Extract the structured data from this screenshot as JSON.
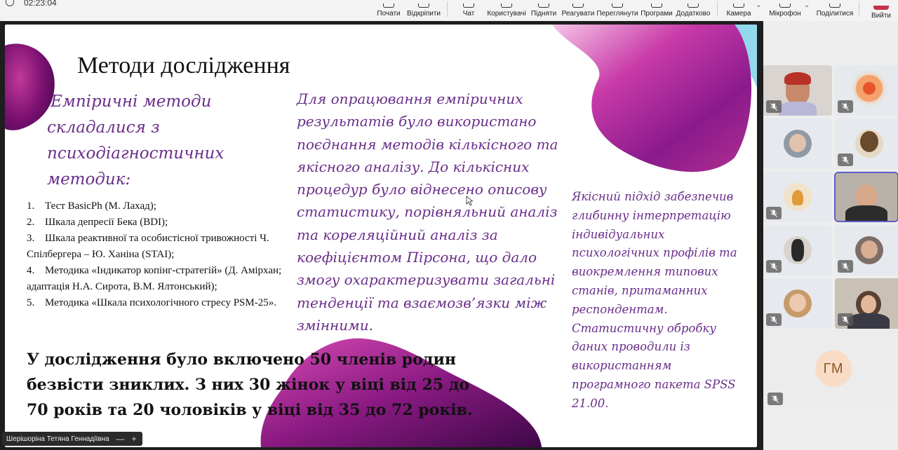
{
  "status": {
    "time": "02:23:04"
  },
  "toolbar": {
    "start_label": "Почати",
    "unpin_label": "Відкріпити",
    "chat_label": "Чат",
    "users_label": "Користувачі",
    "raise_label": "Підняти",
    "react_label": "Реагувати",
    "view_label": "Переглянути",
    "apps_label": "Програми",
    "more_label": "Додатково",
    "camera_label": "Камера",
    "mic_label": "Мікрофон",
    "share_label": "Поділитися",
    "leave_label": "Вийти"
  },
  "slide": {
    "title": "Методи дослідження",
    "empirical_heading": [
      "Емпіричні методи",
      "складалися з",
      "психодіагностичних",
      "методик:"
    ],
    "methods": [
      {
        "num": "1.",
        "text": "Тест BasicPh (М. Лахад);"
      },
      {
        "num": "2.",
        "text": "Шкала депресії Бека (BDI);"
      },
      {
        "num": "3.",
        "text": "Шкала реактивної та особистісної тривожності Ч.",
        "cont": "Спілбергера – Ю. Ханіна (STAI);"
      },
      {
        "num": "4.",
        "text": "Методика «Індикатор копінг-стратегій» (Д. Амірхан;",
        "cont": "адаптація Н.А. Сирота, В.М. Ялтонський);"
      },
      {
        "num": "5.",
        "text": "Методика «Шкала психологічного стресу PSM-25»."
      }
    ],
    "middle_text": " Для опрацювання емпіричних результатів було використано поєднання методів кількісного та якісного аналізу. До кількісних процедур було віднесено описову статистику, порівняльний аналіз та кореляційний аналіз за коефіцієнтом Пірсона, що дало змогу охарактеризувати загальні тенденції та взаємозв’язки між змінними.",
    "right_text": " Якісний підхід забезпечив глибинну інтерпретацію індивідуальних психологічних профілів та виокремлення типових станів, притаманних респондентам. Статистичну обробку даних проводили із використанням програмного пакета SPSS 21.00.",
    "bottom_text": " У дослідження було включено 50 членів родин безвісти зниклих. З них 30 жінок у віці від 25 до 70 років та 20 чоловіків у віці від 35 до 72 років."
  },
  "presenter": {
    "name": "Шерішоріна Тетяна Геннадіївна",
    "minimize_icon": "—",
    "add_icon": "+"
  },
  "participants": {
    "initials_tile": "ГМ"
  },
  "colors": {
    "accent": "#6a2e8a",
    "teams": "#5b5fc7",
    "leave": "#c4314b"
  }
}
